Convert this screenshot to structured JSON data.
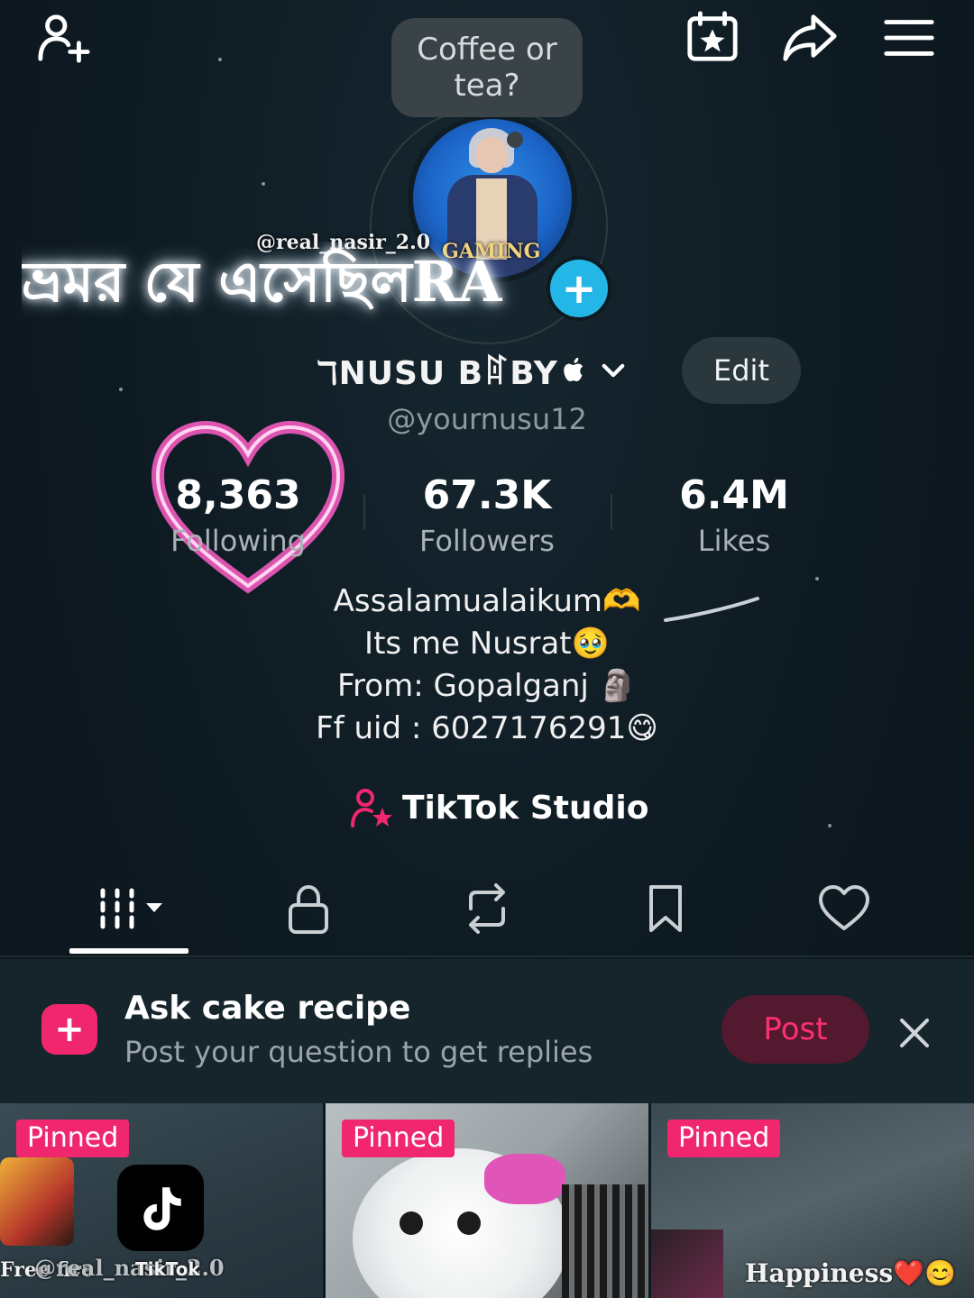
{
  "topbar": {
    "add_friends_icon": "person-plus-icon",
    "events_icon": "calendar-star-icon",
    "share_icon": "share-arrow-icon",
    "menu_icon": "hamburger-menu-icon"
  },
  "bubble": {
    "text": "Coffee or tea?"
  },
  "overlay": {
    "handle": "@real_nasir_2.0",
    "gaming_label": "GAMING",
    "bengali_text": "ভ্রমর যে এসেছিলRA"
  },
  "profile": {
    "display_name": "ℸNUSU BꍏBY",
    "username": "@yournusu12",
    "edit_label": "Edit"
  },
  "stats": [
    {
      "value": "8,363",
      "label": "Following"
    },
    {
      "value": "67.3K",
      "label": "Followers"
    },
    {
      "value": "6.4M",
      "label": "Likes"
    }
  ],
  "bio": [
    "Assalamualaikum🫶",
    "Its me Nusrat🥹",
    "From: Gopalganj 🗿",
    "Ff uid : 6027176291😋"
  ],
  "studio": {
    "label": "TikTok Studio"
  },
  "tabs": [
    "videos-grid-icon",
    "lock-icon",
    "repost-icon",
    "bookmark-icon",
    "heart-icon"
  ],
  "prompt": {
    "title": "Ask cake recipe",
    "subtitle": "Post your question to get replies",
    "post_label": "Post"
  },
  "videos": [
    {
      "badge": "Pinned",
      "caption": "Free fire",
      "caption2": "@real_nasir_2.0",
      "logo_label": "TikTok"
    },
    {
      "badge": "Pinned"
    },
    {
      "badge": "Pinned",
      "caption": "Happiness❤️😊"
    }
  ],
  "colors": {
    "background": "#0e1a22",
    "accent_pink": "#f0276e",
    "avatar_plus": "#25b6e8"
  }
}
